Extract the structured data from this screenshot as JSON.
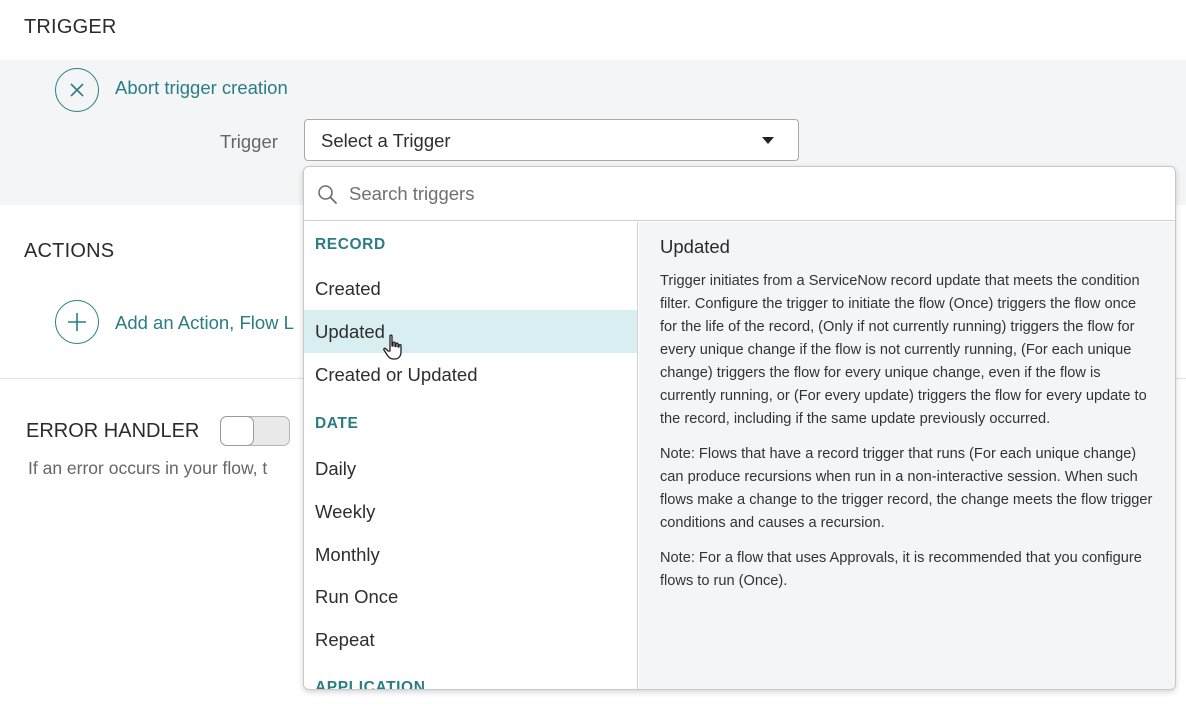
{
  "trigger_section": {
    "title": "TRIGGER",
    "abort_label": "Abort trigger creation",
    "trigger_field_label": "Trigger",
    "select_value": "Select a Trigger"
  },
  "actions_section": {
    "title": "ACTIONS",
    "add_label": "Add an Action, Flow L"
  },
  "error_handler": {
    "title": "ERROR HANDLER",
    "toggle_on": false,
    "description": "If an error occurs in your flow, t"
  },
  "dropdown": {
    "search_placeholder": "Search triggers",
    "groups": [
      {
        "header": "RECORD",
        "options": [
          "Created",
          "Updated",
          "Created or Updated"
        ]
      },
      {
        "header": "DATE",
        "options": [
          "Daily",
          "Weekly",
          "Monthly",
          "Run Once",
          "Repeat"
        ]
      },
      {
        "header": "APPLICATION",
        "options": []
      }
    ],
    "selected_option": "Updated",
    "description": {
      "title": "Updated",
      "paragraphs": [
        "Trigger initiates from a ServiceNow record update that meets the condition filter. Configure the trigger to initiate the flow (Once) triggers the flow once for the life of the record, (Only if not currently running) triggers the flow for every unique change if the flow is not currently running, (For each unique change) triggers the flow for every unique change, even if the flow is currently running, or (For every update) triggers the flow for every update to the record, including if the same update previously occurred.",
        "Note: Flows that have a record trigger that runs (For each unique change) can produce recursions when run in a non-interactive session. When such flows make a change to the trigger record, the change meets the flow trigger conditions and causes a recursion.",
        "Note: For a flow that uses Approvals, it is recommended that you configure flows to run (Once)."
      ]
    }
  },
  "colors": {
    "accent": "#2b7d85",
    "selected_row": "#d8eef0",
    "panel_bg": "#f4f5f6"
  }
}
